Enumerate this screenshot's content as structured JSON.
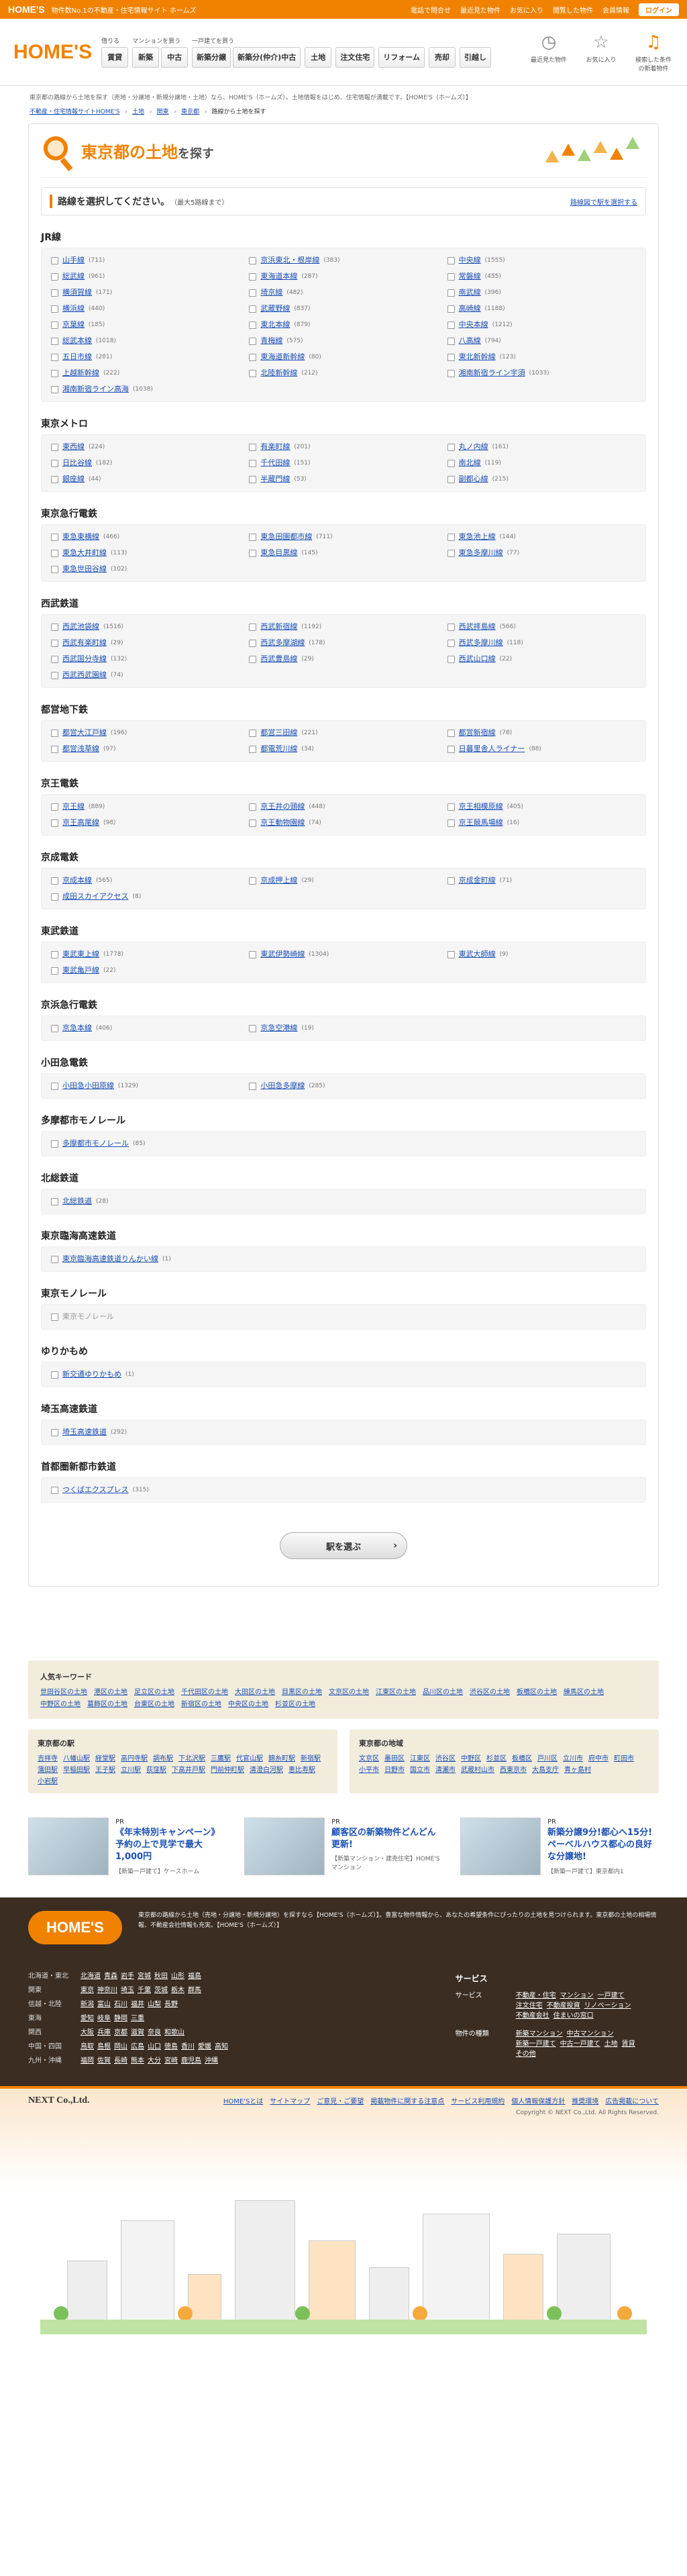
{
  "topbar": {
    "logo": "HOME'S",
    "tagline": "物件数No.1の不動産・住宅情報サイト ホームズ",
    "links": [
      "電話で問合せ",
      "最近見た物件",
      "お気に入り",
      "閲覧した物件",
      "会員情報"
    ],
    "login": "ログイン"
  },
  "header": {
    "logo": "HOME'S",
    "groups": [
      {
        "caption": "借りる",
        "buttons": [
          "賃貸"
        ]
      },
      {
        "caption": "マンションを買う",
        "buttons": [
          "新築",
          "中古"
        ]
      },
      {
        "caption": "一戸建てを買う",
        "buttons": [
          "新築分譲",
          "新築分(仲介)中古"
        ]
      },
      {
        "caption": "",
        "buttons": [
          "土地"
        ]
      },
      {
        "caption": "",
        "buttons": [
          "注文住宅"
        ]
      },
      {
        "caption": "",
        "buttons": [
          "リフォーム"
        ]
      },
      {
        "caption": "",
        "buttons": [
          "売却"
        ]
      },
      {
        "caption": "",
        "buttons": [
          "引越し"
        ]
      }
    ],
    "icons": [
      {
        "label": "最近見た物件",
        "icon": "clock-icon"
      },
      {
        "label": "お気に入り",
        "icon": "star-icon"
      },
      {
        "label": "検索した条件の新着物件",
        "icon": "bell-icon"
      }
    ]
  },
  "intro": "東京都の路線から土地を探す（売地・分譲地・新規分譲地・土地）なら、HOME'S（ホームズ）。土地情報をはじめ、住宅情報が満載です。【HOME'S（ホームズ）】",
  "breadcrumb": [
    "不動産・住宅情報サイトHOME'S",
    "土地",
    "関東",
    "東京都",
    "路線から土地を探す"
  ],
  "hero": {
    "title_accent": "東京都の土地",
    "title_rest": "を探す"
  },
  "instruction": {
    "text": "路線を選択してください。",
    "note": "（最大5路線まで）",
    "map_link": "路線図で駅を選択する"
  },
  "sections": [
    {
      "name": "JR線",
      "items": [
        {
          "n": "山手線",
          "c": "(711)"
        },
        {
          "n": "京浜東北・根岸線",
          "c": "(383)"
        },
        {
          "n": "中央線",
          "c": "(1555)"
        },
        {
          "n": "総武線",
          "c": "(961)"
        },
        {
          "n": "東海道本線",
          "c": "(287)"
        },
        {
          "n": "常磐線",
          "c": "(455)"
        },
        {
          "n": "横須賀線",
          "c": "(171)"
        },
        {
          "n": "埼京線",
          "c": "(482)"
        },
        {
          "n": "南武線",
          "c": "(396)"
        },
        {
          "n": "横浜線",
          "c": "(440)"
        },
        {
          "n": "武蔵野線",
          "c": "(837)"
        },
        {
          "n": "高崎線",
          "c": "(1188)"
        },
        {
          "n": "京葉線",
          "c": "(185)"
        },
        {
          "n": "東北本線",
          "c": "(879)"
        },
        {
          "n": "中央本線",
          "c": "(1212)"
        },
        {
          "n": "総武本線",
          "c": "(1018)"
        },
        {
          "n": "青梅線",
          "c": "(575)"
        },
        {
          "n": "八高線",
          "c": "(794)"
        },
        {
          "n": "五日市線",
          "c": "(281)"
        },
        {
          "n": "東海道新幹線",
          "c": "(80)"
        },
        {
          "n": "東北新幹線",
          "c": "(123)"
        },
        {
          "n": "上越新幹線",
          "c": "(222)"
        },
        {
          "n": "北陸新幹線",
          "c": "(212)"
        },
        {
          "n": "湘南新宿ライン宇須",
          "c": "(1033)"
        },
        {
          "n": "湘南新宿ライン高海",
          "c": "(1038)"
        }
      ]
    },
    {
      "name": "東京メトロ",
      "items": [
        {
          "n": "東西線",
          "c": "(224)"
        },
        {
          "n": "有楽町線",
          "c": "(201)"
        },
        {
          "n": "丸ノ内線",
          "c": "(161)"
        },
        {
          "n": "日比谷線",
          "c": "(182)"
        },
        {
          "n": "千代田線",
          "c": "(151)"
        },
        {
          "n": "南北線",
          "c": "(119)"
        },
        {
          "n": "銀座線",
          "c": "(44)"
        },
        {
          "n": "半蔵門線",
          "c": "(53)"
        },
        {
          "n": "副都心線",
          "c": "(215)"
        }
      ]
    },
    {
      "name": "東京急行電鉄",
      "items": [
        {
          "n": "東急東横線",
          "c": "(466)"
        },
        {
          "n": "東急田園都市線",
          "c": "(711)"
        },
        {
          "n": "東急池上線",
          "c": "(144)"
        },
        {
          "n": "東急大井町線",
          "c": "(113)"
        },
        {
          "n": "東急目黒線",
          "c": "(145)"
        },
        {
          "n": "東急多摩川線",
          "c": "(77)"
        },
        {
          "n": "東急世田谷線",
          "c": "(102)"
        }
      ]
    },
    {
      "name": "西武鉄道",
      "items": [
        {
          "n": "西武池袋線",
          "c": "(1516)"
        },
        {
          "n": "西武新宿線",
          "c": "(1192)"
        },
        {
          "n": "西武拝島線",
          "c": "(566)"
        },
        {
          "n": "西武有楽町線",
          "c": "(29)"
        },
        {
          "n": "西武多摩湖線",
          "c": "(178)"
        },
        {
          "n": "西武多摩川線",
          "c": "(118)"
        },
        {
          "n": "西武国分寺線",
          "c": "(132)"
        },
        {
          "n": "西武豊島線",
          "c": "(29)"
        },
        {
          "n": "西武山口線",
          "c": "(22)"
        },
        {
          "n": "西武西武園線",
          "c": "(74)"
        }
      ]
    },
    {
      "name": "都営地下鉄",
      "items": [
        {
          "n": "都営大江戸線",
          "c": "(196)"
        },
        {
          "n": "都営三田線",
          "c": "(221)"
        },
        {
          "n": "都営新宿線",
          "c": "(78)"
        },
        {
          "n": "都営浅草線",
          "c": "(97)"
        },
        {
          "n": "都電荒川線",
          "c": "(34)"
        },
        {
          "n": "日暮里舎人ライナー",
          "c": "(88)"
        }
      ]
    },
    {
      "name": "京王電鉄",
      "items": [
        {
          "n": "京王線",
          "c": "(889)"
        },
        {
          "n": "京王井の頭線",
          "c": "(448)"
        },
        {
          "n": "京王相模原線",
          "c": "(405)"
        },
        {
          "n": "京王高尾線",
          "c": "(98)"
        },
        {
          "n": "京王動物園線",
          "c": "(74)"
        },
        {
          "n": "京王競馬場線",
          "c": "(16)"
        }
      ]
    },
    {
      "name": "京成電鉄",
      "items": [
        {
          "n": "京成本線",
          "c": "(565)"
        },
        {
          "n": "京成押上線",
          "c": "(29)"
        },
        {
          "n": "京成金町線",
          "c": "(71)"
        },
        {
          "n": "成田スカイアクセス",
          "c": "(8)"
        }
      ]
    },
    {
      "name": "東武鉄道",
      "items": [
        {
          "n": "東武東上線",
          "c": "(1778)"
        },
        {
          "n": "東武伊勢崎線",
          "c": "(1304)"
        },
        {
          "n": "東武大師線",
          "c": "(9)"
        },
        {
          "n": "東武亀戸線",
          "c": "(22)"
        }
      ]
    },
    {
      "name": "京浜急行電鉄",
      "items": [
        {
          "n": "京急本線",
          "c": "(406)"
        },
        {
          "n": "京急空港線",
          "c": "(19)"
        }
      ]
    },
    {
      "name": "小田急電鉄",
      "items": [
        {
          "n": "小田急小田原線",
          "c": "(1329)"
        },
        {
          "n": "小田急多摩線",
          "c": "(285)"
        }
      ]
    },
    {
      "name": "多摩都市モノレール",
      "items": [
        {
          "n": "多摩都市モノレール",
          "c": "(85)"
        }
      ]
    },
    {
      "name": "北総鉄道",
      "items": [
        {
          "n": "北総鉄道",
          "c": "(28)"
        }
      ]
    },
    {
      "name": "東京臨海高速鉄道",
      "items": [
        {
          "n": "東京臨海高速鉄道りんかい線",
          "c": "(1)"
        }
      ]
    },
    {
      "name": "東京モノレール",
      "items": [
        {
          "n": "東京モノレール",
          "c": "",
          "disabled": true
        }
      ]
    },
    {
      "name": "ゆりかもめ",
      "items": [
        {
          "n": "新交通ゆりかもめ",
          "c": "(1)"
        }
      ]
    },
    {
      "name": "埼玉高速鉄道",
      "items": [
        {
          "n": "埼玉高速鉄道",
          "c": "(292)"
        }
      ]
    },
    {
      "name": "首都圏新都市鉄道",
      "items": [
        {
          "n": "つくばエクスプレス",
          "c": "(315)"
        }
      ]
    }
  ],
  "submit": {
    "label": "駅を選ぶ",
    "chevron": "›"
  },
  "keywords": {
    "title": "人気キーワード",
    "items": [
      "世田谷区の土地",
      "港区の土地",
      "足立区の土地",
      "千代田区の土地",
      "大田区の土地",
      "目黒区の土地",
      "文京区の土地",
      "江東区の土地",
      "品川区の土地",
      "渋谷区の土地",
      "板橋区の土地",
      "練馬区の土地",
      "中野区の土地",
      "葛飾区の土地",
      "台東区の土地",
      "新宿区の土地",
      "中央区の土地",
      "杉並区の土地"
    ]
  },
  "stations_box": {
    "title": "東京都の駅",
    "items": [
      "吉祥寺",
      "八幡山駅",
      "経堂駅",
      "高円寺駅",
      "調布駅",
      "下北沢駅",
      "三鷹駅",
      "代官山駅",
      "錦糸町駅",
      "新宿駅",
      "蒲田駅",
      "早稲田駅",
      "王子駅",
      "立川駅",
      "荻窪駅",
      "下高井戸駅",
      "門前仲町駅",
      "清澄白河駅",
      "恵比寿駅",
      "小岩駅"
    ]
  },
  "cities_box": {
    "title": "東京都の地域",
    "items": [
      "文京区",
      "墨田区",
      "江東区",
      "渋谷区",
      "中野区",
      "杉並区",
      "板橋区",
      "戸川区",
      "立川市",
      "府中市",
      "町田市",
      "小平市",
      "日野市",
      "国立市",
      "清瀬市",
      "武蔵村山市",
      "西東京市",
      "大島支庁",
      "青ヶ島村"
    ]
  },
  "prs": [
    {
      "tag": "PR",
      "title": "《年末特別キャンペーン》予約の上で見学で最大1,000円",
      "sub": "【新築一戸建て】ケースホーム"
    },
    {
      "tag": "PR",
      "title": "顧客区の新築物件どんどん更新!",
      "sub": "【新築マンション・建売住宅】HOME'Sマンション"
    },
    {
      "tag": "PR",
      "title": "新築分譲9分!都心へ15分!ペーベルハウス都心の良好な分譲地!",
      "sub": "【新築一戸建て】東京都内1"
    }
  ],
  "footer": {
    "logo": "HOME'S",
    "description": "東京都の路線から土地（売地・分譲地・新規分譲地）を探すなら【HOME'S（ホームズ）】。豊富な物件情報から、あなたの希望条件にぴったりの土地を見つけられます。東京都の土地の相場情報、不動産会社情報も充実。【HOME'S（ホームズ）】",
    "areas": [
      {
        "region": "北海道・東北",
        "links": [
          "北海道",
          "青森",
          "岩手",
          "宮城",
          "秋田",
          "山形",
          "福島"
        ]
      },
      {
        "region": "関東",
        "links": [
          "東京",
          "神奈川",
          "埼玉",
          "千葉",
          "茨城",
          "栃木",
          "群馬"
        ]
      },
      {
        "region": "信越・北陸",
        "links": [
          "新潟",
          "富山",
          "石川",
          "福井",
          "山梨",
          "長野"
        ]
      },
      {
        "region": "東海",
        "links": [
          "愛知",
          "岐阜",
          "静岡",
          "三重"
        ]
      },
      {
        "region": "関西",
        "links": [
          "大阪",
          "兵庫",
          "京都",
          "滋賀",
          "奈良",
          "和歌山"
        ]
      },
      {
        "region": "中国・四国",
        "links": [
          "鳥取",
          "島根",
          "岡山",
          "広島",
          "山口",
          "徳島",
          "香川",
          "愛媛",
          "高知"
        ]
      },
      {
        "region": "九州・沖縄",
        "links": [
          "福岡",
          "佐賀",
          "長崎",
          "熊本",
          "大分",
          "宮崎",
          "鹿児島",
          "沖縄"
        ]
      }
    ],
    "services": {
      "title": "サービス",
      "groups": [
        {
          "label": "サービス",
          "links": [
            "不動産・住宅",
            "マンション",
            "一戸建て",
            "注文住宅",
            "不動産投資",
            "リノベーション",
            "不動産会社",
            "住まいの窓口"
          ]
        },
        {
          "label": "物件の種類",
          "links": [
            "新築マンション",
            "中古マンション",
            "新築一戸建て",
            "中古一戸建て",
            "土地",
            "賃貸",
            "その他"
          ]
        }
      ]
    },
    "company": "NEXT Co.,Ltd.",
    "bottom_links": [
      "HOME'Sとは",
      "サイトマップ",
      "ご意見・ご要望",
      "掲載物件に関する注意点",
      "サービス利用規約",
      "個人情報保護方針",
      "推奨環境",
      "広告掲載について"
    ],
    "copyright": "Copyright © NEXT Co.,Ltd. All Rights Reserved."
  }
}
